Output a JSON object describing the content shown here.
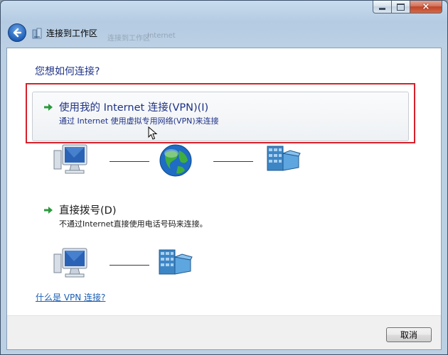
{
  "window": {
    "title": "连接到工作区",
    "background_text": [
      "连接到工作区",
      "Internet"
    ]
  },
  "caption_buttons": {
    "minimize": "minimize",
    "maximize": "maximize",
    "close": "×"
  },
  "heading": "您想如何连接?",
  "options": [
    {
      "title": "使用我的 Internet 连接(VPN)(I)",
      "description": "通过 Internet 使用虚拟专用网络(VPN)来连接"
    },
    {
      "title": "直接拨号(D)",
      "description": "不通过Internet直接使用电话号码来连接。"
    }
  ],
  "help_link": "什么是 VPN 连接?",
  "cancel_label": "取消",
  "colors": {
    "accent": "#1e3287",
    "highlight_box": "#d6202a",
    "link": "#1a5fb4",
    "arrow": "#2b9a3c"
  },
  "icons": [
    "back-arrow-icon",
    "network-icon",
    "green-arrow-icon",
    "computer-icon",
    "globe-icon",
    "office-building-icon",
    "mouse-cursor-icon"
  ]
}
